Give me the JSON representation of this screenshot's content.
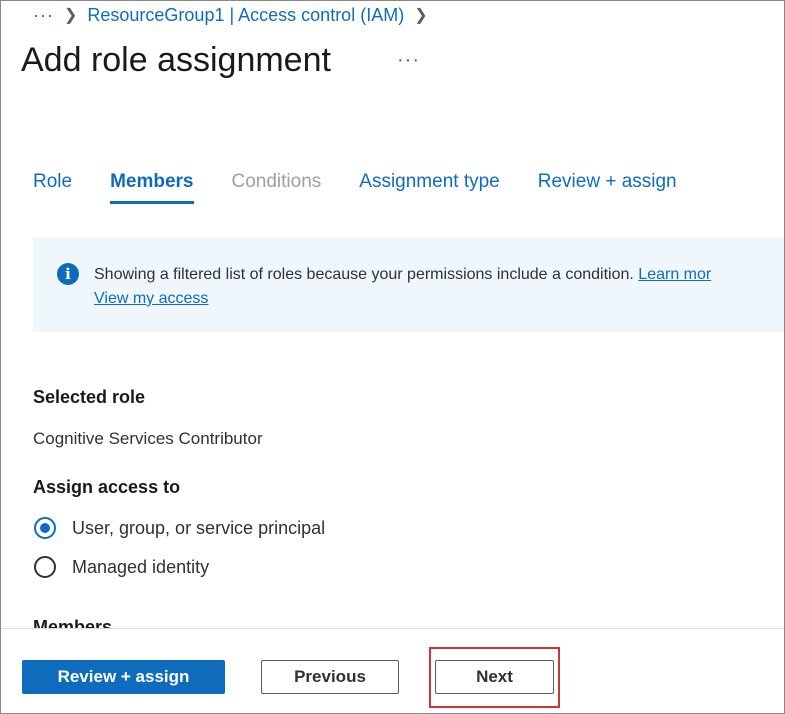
{
  "breadcrumb": {
    "ellipsis": "···",
    "items": [
      "ResourceGroup1 | Access control (IAM)"
    ]
  },
  "header": {
    "title": "Add role assignment",
    "more": "···"
  },
  "tabs": [
    {
      "label": "Role",
      "state": "normal"
    },
    {
      "label": "Members",
      "state": "active"
    },
    {
      "label": "Conditions",
      "state": "disabled"
    },
    {
      "label": "Assignment type",
      "state": "normal"
    },
    {
      "label": "Review + assign",
      "state": "normal"
    }
  ],
  "info_banner": {
    "icon": "info-icon",
    "text": "Showing a filtered list of roles because your permissions include a condition.",
    "learn_more": "Learn mor",
    "view_access": "View my access"
  },
  "selected_role": {
    "label": "Selected role",
    "value": "Cognitive Services Contributor"
  },
  "assign_access": {
    "label": "Assign access to",
    "options": [
      {
        "label": "User, group, or service principal",
        "checked": true
      },
      {
        "label": "Managed identity",
        "checked": false
      }
    ]
  },
  "members_label": "Members",
  "footer": {
    "review_assign": "Review + assign",
    "previous": "Previous",
    "next": "Next"
  },
  "colors": {
    "accent": "#0f6cbd",
    "highlight": "#d13438",
    "info_bg": "#eff6fc"
  }
}
